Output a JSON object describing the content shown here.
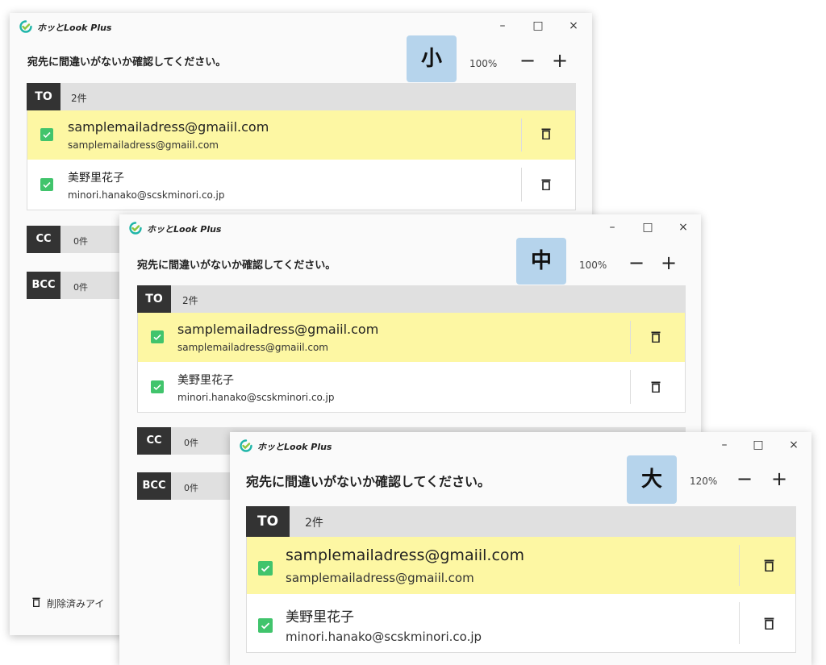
{
  "app": {
    "name": "ホッとLook Plus",
    "window_controls": {
      "minimize": "–",
      "maximize": "□",
      "close": "×"
    }
  },
  "dialog": {
    "message": "宛先に間違いがないか確認してください。",
    "footer_button": "削除済みアイ"
  },
  "sections": {
    "to": {
      "label": "TO",
      "count": "2件"
    },
    "cc": {
      "label": "CC",
      "count": "0件"
    },
    "bcc": {
      "label": "BCC",
      "count": "0件"
    }
  },
  "recipients": [
    {
      "name": "samplemailadress@gmaiil.com",
      "address": "samplemailadress@gmaiil.com",
      "checked": true,
      "highlighted": true
    },
    {
      "name": "美野里花子",
      "address": "minori.hanako@scskminori.co.jp",
      "checked": true,
      "highlighted": false
    }
  ],
  "windows": [
    {
      "size_label": "小",
      "zoom": "100%"
    },
    {
      "size_label": "中",
      "zoom": "100%"
    },
    {
      "size_label": "大",
      "zoom": "120%"
    }
  ],
  "controls": {
    "zoom_out": "−",
    "zoom_in": "+"
  },
  "colors": {
    "highlight_row": "#fdf7a3",
    "checkbox": "#41c46c",
    "size_badge": "#b6d4ec",
    "section_label_bg": "#333333",
    "section_header_bg": "#e0e0e0"
  },
  "icons": [
    "app-logo-icon",
    "checkbox-checked-icon",
    "trash-icon"
  ]
}
